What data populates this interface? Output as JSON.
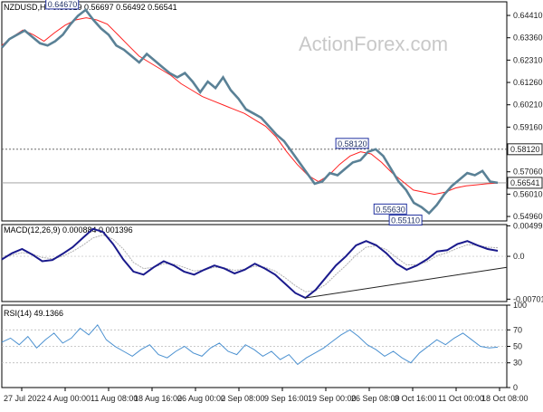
{
  "watermark": "ActionForex.com",
  "colors": {
    "price": "#5a8196",
    "ma": "#ff2020",
    "macd_hist": "#1a1a8c",
    "macd_signal": "#b0b0b0",
    "rsi": "#4a90d0",
    "trendline": "#222222",
    "label_box": "#2030a0",
    "level_box": "#222222"
  },
  "chart_data": [
    {
      "type": "candlestick",
      "title": "NZDUSD,H4  0.56519 0.56697 0.56492 0.56541",
      "ylim": [
        0.5475,
        0.6505
      ],
      "y_ticks": [
        "0.64410",
        "0.63360",
        "0.62310",
        "0.61260",
        "0.60210",
        "0.59160",
        "0.57060",
        "0.56010",
        "0.54960"
      ],
      "y_tick_values": [
        0.6441,
        0.6336,
        0.6231,
        0.6126,
        0.6021,
        0.5916,
        0.5706,
        0.5601,
        0.5496
      ],
      "current_price": "0.56541",
      "current_value": 0.56541,
      "level": "0.58120",
      "level_value": 0.5812,
      "series": [
        {
          "values": [
            0.63,
            0.634,
            0.6372,
            0.635,
            0.632,
            0.636,
            0.6395,
            0.642,
            0.643,
            0.642,
            0.64,
            0.635,
            0.63,
            0.625,
            0.622,
            0.619,
            0.616,
            0.612,
            0.609,
            0.606,
            0.604,
            0.602,
            0.6,
            0.598,
            0.595,
            0.592,
            0.587,
            0.58,
            0.574,
            0.569,
            0.566,
            0.569,
            0.574,
            0.578,
            0.58,
            0.579,
            0.575,
            0.57,
            0.566,
            0.562,
            0.561,
            0.56,
            0.561,
            0.563,
            0.564,
            0.5645,
            0.565,
            0.5653
          ]
        },
        {
          "values": [
            0.629,
            0.633,
            0.635,
            0.637,
            0.634,
            0.631,
            0.63,
            0.632,
            0.635,
            0.64,
            0.644,
            0.6467,
            0.642,
            0.638,
            0.635,
            0.63,
            0.628,
            0.625,
            0.622,
            0.626,
            0.623,
            0.62,
            0.617,
            0.615,
            0.617,
            0.613,
            0.608,
            0.613,
            0.61,
            0.615,
            0.609,
            0.605,
            0.6,
            0.598,
            0.596,
            0.592,
            0.588,
            0.585,
            0.58,
            0.575,
            0.57,
            0.565,
            0.566,
            0.57,
            0.569,
            0.572,
            0.575,
            0.576,
            0.58,
            0.5812,
            0.578,
            0.572,
            0.566,
            0.562,
            0.556,
            0.554,
            0.5511,
            0.555,
            0.56,
            0.564,
            0.567,
            0.57,
            0.569,
            0.571,
            0.566,
            0.5654
          ]
        }
      ],
      "annotations": [
        {
          "text": "0.64670",
          "value": 0.6467
        },
        {
          "text": "0.58120",
          "value": 0.5812
        },
        {
          "text": "0.55630",
          "value": 0.5563
        },
        {
          "text": "0.55110",
          "value": 0.5511
        }
      ]
    },
    {
      "type": "line",
      "title": "MACD(12,26,9) 0.000884 0.001396",
      "ylim": [
        -0.0074,
        0.0052
      ],
      "y_ticks": [
        "0.004995",
        "0.0",
        "-0.007011"
      ],
      "y_tick_values": [
        0.004995,
        0.0,
        -0.007011
      ],
      "series": [
        {
          "values": [
            -0.0005,
            0.0005,
            0.0012,
            0.0003,
            -0.0008,
            -0.0006,
            0.0004,
            0.0015,
            0.003,
            0.0045,
            0.004,
            0.002,
            -0.0005,
            -0.0025,
            -0.003,
            -0.0018,
            -0.0008,
            -0.0015,
            -0.0025,
            -0.003,
            -0.0022,
            -0.0015,
            -0.002,
            -0.0028,
            -0.0022,
            -0.0012,
            -0.002,
            -0.003,
            -0.0045,
            -0.006,
            -0.0068,
            -0.0055,
            -0.0035,
            -0.0015,
            0.0,
            0.0018,
            0.0025,
            0.0018,
            0.0005,
            -0.0012,
            -0.0022,
            -0.0015,
            -0.0005,
            0.0008,
            0.001,
            0.002,
            0.0025,
            0.0018,
            0.0012,
            0.0009
          ]
        },
        {
          "values": [
            0.0,
            0.0002,
            0.0006,
            0.0004,
            -0.0002,
            -0.0004,
            0.0,
            0.0008,
            0.0018,
            0.003,
            0.0035,
            0.0028,
            0.0012,
            -0.001,
            -0.002,
            -0.0018,
            -0.0012,
            -0.0013,
            -0.0018,
            -0.0024,
            -0.0022,
            -0.0018,
            -0.0019,
            -0.0023,
            -0.0021,
            -0.0016,
            -0.0018,
            -0.0024,
            -0.0035,
            -0.0048,
            -0.0058,
            -0.0056,
            -0.0046,
            -0.003,
            -0.0015,
            0.0002,
            0.0015,
            0.0017,
            0.0011,
            -0.0002,
            -0.0014,
            -0.0014,
            -0.0009,
            0.0001,
            0.0006,
            0.0013,
            0.0019,
            0.0018,
            0.0015,
            0.0014
          ]
        }
      ]
    },
    {
      "type": "line",
      "title": "RSI(14) 49.1366",
      "ylim": [
        0,
        100
      ],
      "y_ticks": [
        "100",
        "70",
        "50",
        "30",
        "0"
      ],
      "y_tick_values": [
        100,
        70,
        50,
        30,
        0
      ],
      "series": [
        {
          "values": [
            55,
            60,
            52,
            62,
            48,
            58,
            66,
            54,
            60,
            72,
            64,
            76,
            58,
            50,
            44,
            38,
            46,
            52,
            40,
            36,
            44,
            50,
            42,
            38,
            48,
            54,
            44,
            40,
            52,
            46,
            38,
            44,
            34,
            40,
            28,
            36,
            42,
            48,
            56,
            64,
            70,
            62,
            52,
            46,
            38,
            44,
            36,
            30,
            42,
            50,
            58,
            52,
            60,
            66,
            58,
            50,
            48,
            49
          ]
        }
      ]
    }
  ],
  "x_labels": [
    "27 Jul 2022",
    "4 Aug 00:00",
    "11 Aug 08:00",
    "18 Aug 16:00",
    "26 Aug 00:00",
    "2 Sep 08:00",
    "9 Sep 16:00",
    "19 Sep 00:00",
    "26 Sep 08:00",
    "3 Oct 16:00",
    "11 Oct 00:00",
    "18 Oct 08:00"
  ]
}
